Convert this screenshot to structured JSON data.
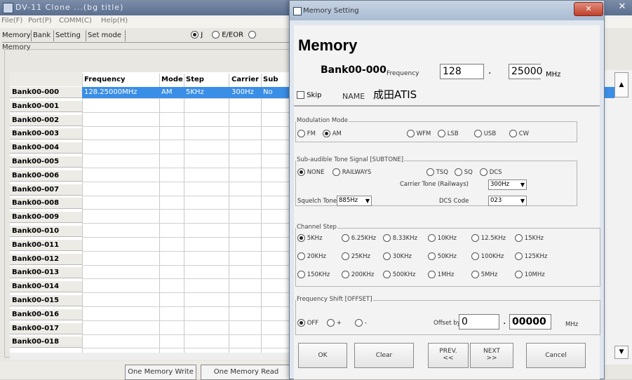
{
  "bg": {
    "title": "DV-11 Clone ...(bg title)",
    "menu": [
      "File(F)",
      "Port(P)",
      "COMM(C)",
      "Help(H)"
    ],
    "tabs": [
      "Memory",
      "Bank",
      "Setting",
      "Set mode"
    ],
    "group_label": "Memory",
    "radio1": "J",
    "radio2": "E/EOR",
    "columns": [
      "Frequency",
      "Mode",
      "Step",
      "Carrier",
      "Sub"
    ],
    "rows": [
      "Bank00-000",
      "Bank00-001",
      "Bank00-002",
      "Bank00-003",
      "Bank00-004",
      "Bank00-005",
      "Bank00-006",
      "Bank00-007",
      "Bank00-008",
      "Bank00-009",
      "Bank00-010",
      "Bank00-011",
      "Bank00-012",
      "Bank00-013",
      "Bank00-014",
      "Bank00-015",
      "Bank00-016",
      "Bank00-017",
      "Bank00-018"
    ],
    "selected": {
      "frequency": "128.25000MHz",
      "mode": "AM",
      "step": "5KHz",
      "carrier": "300Hz",
      "sub": "No"
    },
    "btn_write": "One Memory Write",
    "btn_read": "One Memory Read"
  },
  "dialog": {
    "title": "Memory Setting",
    "heading": "Memory",
    "bank": "Bank00-000",
    "freq_label": "Frequency",
    "freq_int": "128",
    "freq_frac": "25000",
    "freq_unit": "MHz",
    "skip": "Skip",
    "name_label": "NAME",
    "name_value": "成田ATIS",
    "modulation": {
      "title": "Modulation Mode",
      "options": [
        "FM",
        "AM",
        "WFM",
        "LSB",
        "USB",
        "CW"
      ],
      "selected": "AM"
    },
    "subtone": {
      "title": "Sub-audible Tone Signal [SUBTONE]",
      "options": [
        "NONE",
        "RAILWAYS",
        "TSQ",
        "SQ",
        "DCS"
      ],
      "selected": "NONE",
      "carrier_label": "Carrier Tone (Railways)",
      "carrier_value": "300Hz",
      "squelch_label": "Squelch Tone",
      "squelch_value": "885Hz",
      "dcs_label": "DCS Code",
      "dcs_value": "023"
    },
    "step": {
      "title": "Channel Step",
      "options": [
        "5KHz",
        "6.25KHz",
        "8.33KHz",
        "10KHz",
        "12.5KHz",
        "15KHz",
        "20KHz",
        "25KHz",
        "30KHz",
        "50KHz",
        "100KHz",
        "125KHz",
        "150KHz",
        "200KHz",
        "500KHz",
        "1MHz",
        "5MHz",
        "10MHz"
      ],
      "selected": "5KHz"
    },
    "shift": {
      "title": "Frequency Shift [OFFSET]",
      "options": [
        "OFF",
        "+",
        "-"
      ],
      "selected": "OFF",
      "offset_label": "Offset by",
      "offset_int": "0",
      "offset_frac": "00000",
      "offset_unit": "MHz"
    },
    "buttons": {
      "ok": "OK",
      "clear": "Clear",
      "prev": "PREV.",
      "prev_sym": "<<",
      "next": "NEXT",
      "next_sym": ">>",
      "cancel": "Cancel"
    }
  }
}
